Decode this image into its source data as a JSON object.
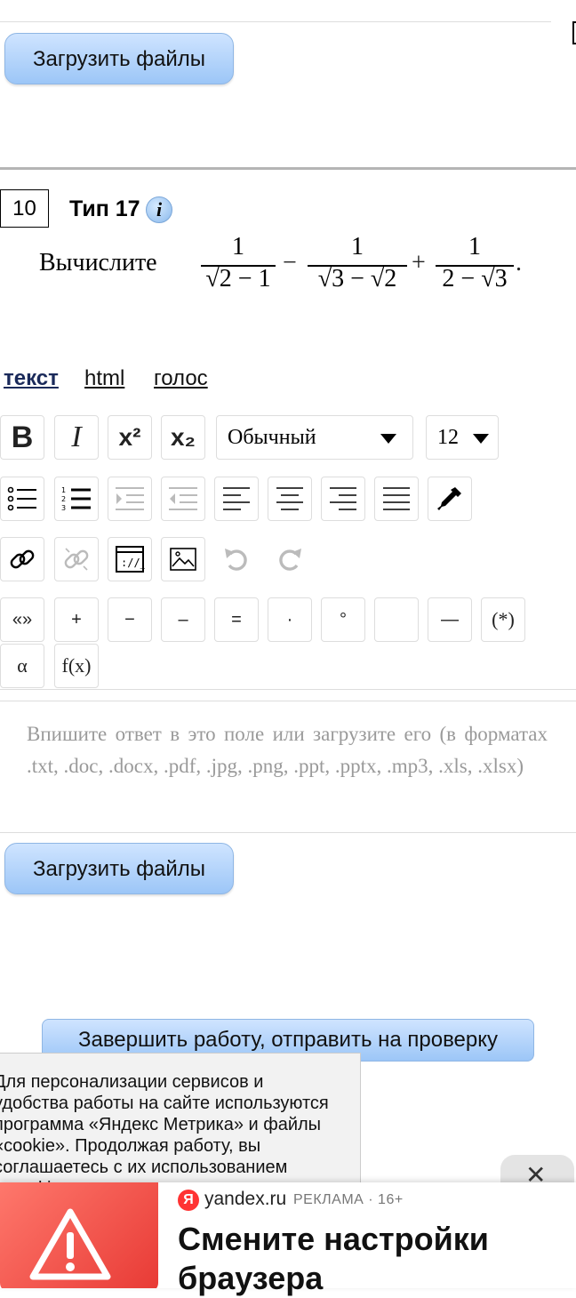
{
  "top": {
    "upload_label": "Загрузить файлы"
  },
  "question": {
    "number": "10",
    "type_label": "Тип 17",
    "info_glyph": "i",
    "prompt": "Вычислите",
    "formula": {
      "f1": {
        "num": "1",
        "den": "√2 − 1"
      },
      "op1": "−",
      "f2": {
        "num": "1",
        "den": "√3 − √2"
      },
      "op2": "+",
      "f3": {
        "num": "1",
        "den": "2 − √3"
      },
      "end": "."
    }
  },
  "tabs": [
    {
      "label": "текст",
      "active": true
    },
    {
      "label": "html",
      "active": false
    },
    {
      "label": "голос",
      "active": false
    }
  ],
  "toolbar": {
    "bold": "B",
    "italic": "I",
    "superscript": "x²",
    "subscript": "x₂",
    "style_value": "Обычный",
    "size_value": "12",
    "chars": [
      "«»",
      "+",
      "−",
      "–",
      "=",
      "·",
      "°",
      "",
      "—",
      "(*)",
      "α",
      "f(x)"
    ]
  },
  "answer": {
    "placeholder": "Впишите ответ в это поле или загрузите его (в форматах .txt, .doc, .docx, .pdf, .jpg, .png, .ppt, .pptx, .mp3, .xls, .xlsx)",
    "upload_label": "Загрузить файлы"
  },
  "finish_label": "Завершить работу, отправить на проверку",
  "cookie_text": "Для персонализации сервисов и удобства работы на сайте используются программа «Яндекс Метрика» и файлы «cookie». Продолжая работу, вы соглашаетесь с их использованием («cookie»",
  "ad": {
    "domain": "yandex.ru",
    "label": "РЕКЛАМА · 16+",
    "ya_glyph": "Я",
    "headline": "Смените настройки браузера",
    "close_glyph": "✕"
  },
  "colors": {
    "button_top": "#cfe4ff",
    "button_bottom": "#9cc6f7",
    "ad_red": "#e83a35"
  }
}
